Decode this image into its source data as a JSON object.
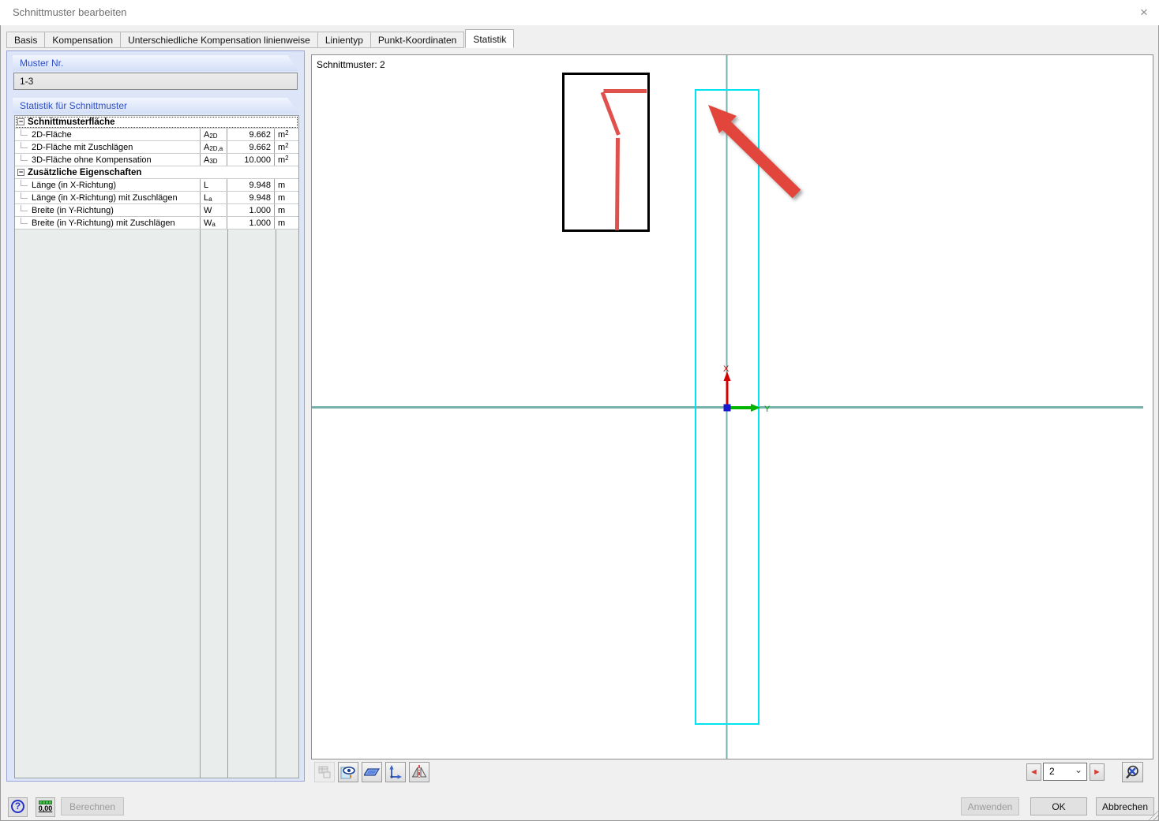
{
  "window": {
    "title": "Schnittmuster bearbeiten"
  },
  "tabs": [
    {
      "label": "Basis",
      "active": false
    },
    {
      "label": "Kompensation",
      "active": false
    },
    {
      "label": "Unterschiedliche Kompensation linienweise",
      "active": false
    },
    {
      "label": "Linientyp",
      "active": false
    },
    {
      "label": "Punkt-Koordinaten",
      "active": false
    },
    {
      "label": "Statistik",
      "active": true
    }
  ],
  "sidebar": {
    "muster_nr": {
      "label": "Muster Nr.",
      "value": "1-3"
    },
    "statistik": {
      "label": "Statistik für Schnittmuster",
      "groups": [
        {
          "title": "Schnittmusterfläche",
          "rows": [
            {
              "name": "2D-Fläche",
              "symbol_base": "A",
              "symbol_sub": "2D",
              "value": "9.662",
              "unit": "m",
              "unit_sup": "2"
            },
            {
              "name": "2D-Fläche mit Zuschlägen",
              "symbol_base": "A",
              "symbol_sub": "2D,a",
              "value": "9.662",
              "unit": "m",
              "unit_sup": "2"
            },
            {
              "name": "3D-Fläche ohne Kompensation",
              "symbol_base": "A",
              "symbol_sub": "3D",
              "value": "10.000",
              "unit": "m",
              "unit_sup": "2"
            }
          ]
        },
        {
          "title": "Zusätzliche Eigenschaften",
          "rows": [
            {
              "name": "Länge (in X-Richtung)",
              "symbol_base": "L",
              "symbol_sub": "",
              "value": "9.948",
              "unit": "m",
              "unit_sup": ""
            },
            {
              "name": "Länge (in X-Richtung) mit Zuschlägen",
              "symbol_base": "L",
              "symbol_sub": "a",
              "value": "9.948",
              "unit": "m",
              "unit_sup": ""
            },
            {
              "name": "Breite (in Y-Richtung)",
              "symbol_base": "W",
              "symbol_sub": "",
              "value": "1.000",
              "unit": "m",
              "unit_sup": ""
            },
            {
              "name": "Breite (in Y-Richtung) mit Zuschlägen",
              "symbol_base": "W",
              "symbol_sub": "a",
              "value": "1.000",
              "unit": "m",
              "unit_sup": ""
            }
          ]
        }
      ]
    }
  },
  "viewport": {
    "label": "Schnittmuster: 2",
    "axis_x": "X",
    "axis_y": "Y"
  },
  "pager": {
    "value": "2"
  },
  "footer": {
    "berechnen": "Berechnen",
    "anwenden": "Anwenden",
    "ok": "OK",
    "abbrechen": "Abbrechen",
    "units_label": "0,00"
  },
  "icons": {
    "close": "×",
    "collapse": "−",
    "prev": "◄",
    "next": "►",
    "dropdown_chevron": "⌄",
    "help": "?"
  },
  "colors": {
    "selected_pattern_cyan": "#00e4f2",
    "pattern_red": "#e0514d",
    "annotation_arrow_red": "#e2453c",
    "grid_teal": "#76b2ab",
    "axis_x_red": "#d40000",
    "axis_y_green": "#00a800",
    "origin_blue": "#1818cc",
    "label_blue": "#3050c8"
  }
}
